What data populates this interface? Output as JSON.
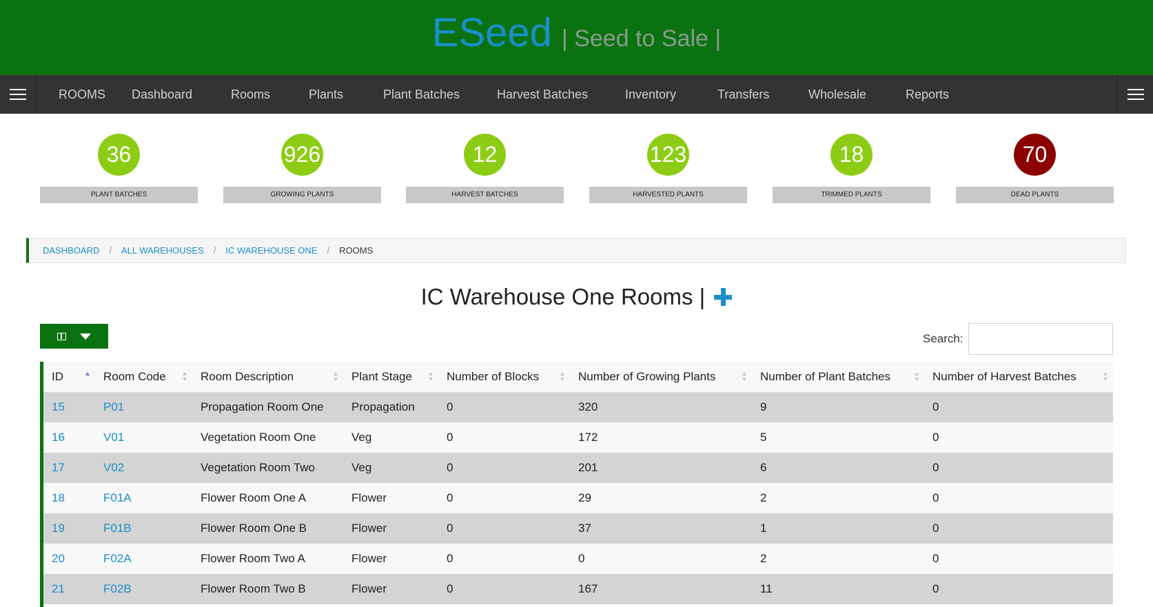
{
  "brand": {
    "name": "ESeed",
    "tagline": "| Seed to Sale |"
  },
  "nav": {
    "section": "ROOMS",
    "items": [
      "Dashboard",
      "Rooms",
      "Plants",
      "Plant Batches",
      "Harvest Batches",
      "Inventory",
      "Transfers",
      "Wholesale",
      "Reports"
    ]
  },
  "stats": [
    {
      "value": "36",
      "label": "PLANT BATCHES",
      "color": "#8dcc14"
    },
    {
      "value": "926",
      "label": "GROWING PLANTS",
      "color": "#8dcc14"
    },
    {
      "value": "12",
      "label": "HARVEST BATCHES",
      "color": "#8dcc14"
    },
    {
      "value": "123",
      "label": "HARVESTED PLANTS",
      "color": "#8dcc14"
    },
    {
      "value": "18",
      "label": "TRIMMED PLANTS",
      "color": "#8dcc14"
    },
    {
      "value": "70",
      "label": "DEAD PLANTS",
      "color": "#8b0000"
    }
  ],
  "breadcrumb": {
    "items": [
      "DASHBOARD",
      "ALL WAREHOUSES",
      "IC WAREHOUSE ONE"
    ],
    "separator": "/",
    "active": "ROOMS"
  },
  "page": {
    "title": "IC Warehouse One Rooms |"
  },
  "search": {
    "label": "Search:",
    "value": ""
  },
  "table": {
    "columns": [
      "ID",
      "Room Code",
      "Room Description",
      "Plant Stage",
      "Number of Blocks",
      "Number of Growing Plants",
      "Number of Plant Batches",
      "Number of Harvest Batches"
    ],
    "rows": [
      [
        "15",
        "P01",
        "Propagation Room One",
        "Propagation",
        "0",
        "320",
        "9",
        "0"
      ],
      [
        "16",
        "V01",
        "Vegetation Room One",
        "Veg",
        "0",
        "172",
        "5",
        "0"
      ],
      [
        "17",
        "V02",
        "Vegetation Room Two",
        "Veg",
        "0",
        "201",
        "6",
        "0"
      ],
      [
        "18",
        "F01A",
        "Flower Room One A",
        "Flower",
        "0",
        "29",
        "2",
        "0"
      ],
      [
        "19",
        "F01B",
        "Flower Room One B",
        "Flower",
        "0",
        "37",
        "1",
        "0"
      ],
      [
        "20",
        "F02A",
        "Flower Room Two A",
        "Flower",
        "0",
        "0",
        "2",
        "0"
      ],
      [
        "21",
        "F02B",
        "Flower Room Two B",
        "Flower",
        "0",
        "167",
        "11",
        "0"
      ]
    ]
  },
  "colors": {
    "header_green": "#0b7212",
    "link_blue": "#1a8fc9",
    "nav_dark": "#333333",
    "stat_green": "#8dcc14",
    "stat_red": "#8b0000"
  },
  "icons": [
    "hamburger-icon",
    "columns-icon",
    "caret-down-icon",
    "plus-icon",
    "sort-icon"
  ]
}
